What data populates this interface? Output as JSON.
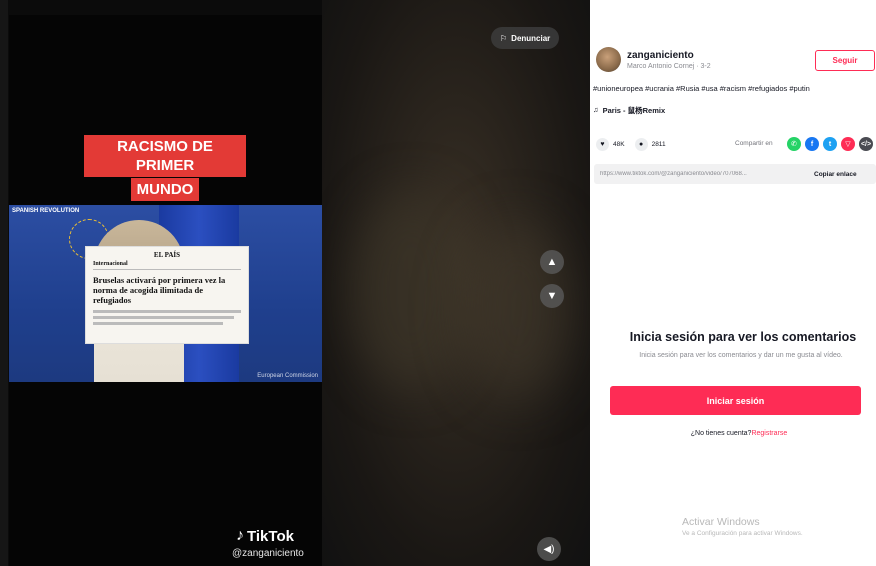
{
  "video": {
    "caption_line1": "RACISMO DE PRIMER",
    "caption_line2": "MUNDO",
    "photo_sponsor": "SPANISH REVOLUTION",
    "photo_credit": "European Commission",
    "article": {
      "brand": "EL PAÍS",
      "section": "Internacional",
      "headline": "Bruselas activará por primera vez la norma de acogida ilimitada de refugiados"
    },
    "watermark_brand": "TikTok",
    "watermark_user": "@zanganiciento",
    "report_label": "Denunciar"
  },
  "author": {
    "username": "zanganiciento",
    "subtitle": "Marco Antonio Cornej · 3-2",
    "follow_label": "Seguir"
  },
  "post": {
    "hashtags": "#unioneuropea #ucrania #Rusia #usa #racism #refugiados #putin",
    "music": "Paris - 鼠杨Remix"
  },
  "stats": {
    "likes": "48K",
    "comments": "2811",
    "share_label": "Compartir en"
  },
  "link": {
    "url": "https://www.tiktok.com/@zanganiciento/video/707068...",
    "copy_label": "Copiar enlace"
  },
  "login": {
    "title": "Inicia sesión para ver los comentarios",
    "subtitle": "Inicia sesión para ver los comentarios y dar un me gusta al vídeo.",
    "button": "Iniciar sesión",
    "no_account": "¿No tienes cuenta?",
    "register": "Registrarse"
  },
  "windows": {
    "title": "Activar Windows",
    "subtitle": "Ve a Configuración para activar Windows."
  },
  "colors": {
    "accent": "#fe2c55",
    "caption_bg": "#e33a36"
  },
  "icons": {
    "flag": "flag-icon",
    "up": "chevron-up-icon",
    "down": "chevron-down-icon",
    "sound": "volume-icon",
    "heart": "heart-icon",
    "comment": "comment-icon",
    "music": "music-note-icon"
  }
}
